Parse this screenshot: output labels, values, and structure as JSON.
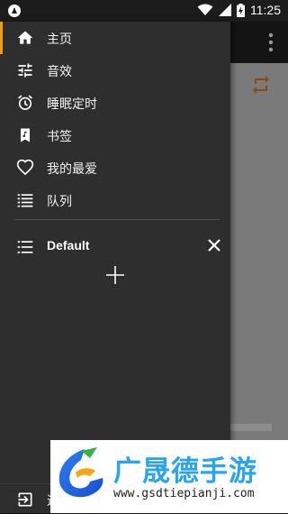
{
  "status_bar": {
    "time": "11:25",
    "icons": [
      "android-icon",
      "wifi-icon",
      "signal-icon",
      "battery-charging-icon"
    ]
  },
  "drawer": {
    "items": [
      {
        "label": "主页",
        "icon": "home-icon",
        "active": true
      },
      {
        "label": "音效",
        "icon": "equalizer-icon"
      },
      {
        "label": "睡眠定时",
        "icon": "alarm-icon"
      },
      {
        "label": "书签",
        "icon": "bookmark-icon"
      },
      {
        "label": "我的最爱",
        "icon": "heart-icon"
      },
      {
        "label": "队列",
        "icon": "queue-icon"
      }
    ],
    "playlist": {
      "label": "Default",
      "icon": "playlist-icon",
      "close_icon": "close-icon"
    },
    "add_icon": "plus-icon",
    "bottom": {
      "label": "退",
      "icon": "exit-icon"
    }
  },
  "background_app": {
    "menu_icon": "more-vert-icon",
    "repeat_icon": "repeat-icon"
  },
  "watermark": {
    "brand": "广晟德手游",
    "url": "www.gsdtiepianji.com"
  },
  "colors": {
    "accent": "#f29b11",
    "drawer_bg": "#2e2e2e",
    "repeat_icon": "#8a4a12",
    "brand_blue": "#2aa4ea"
  }
}
